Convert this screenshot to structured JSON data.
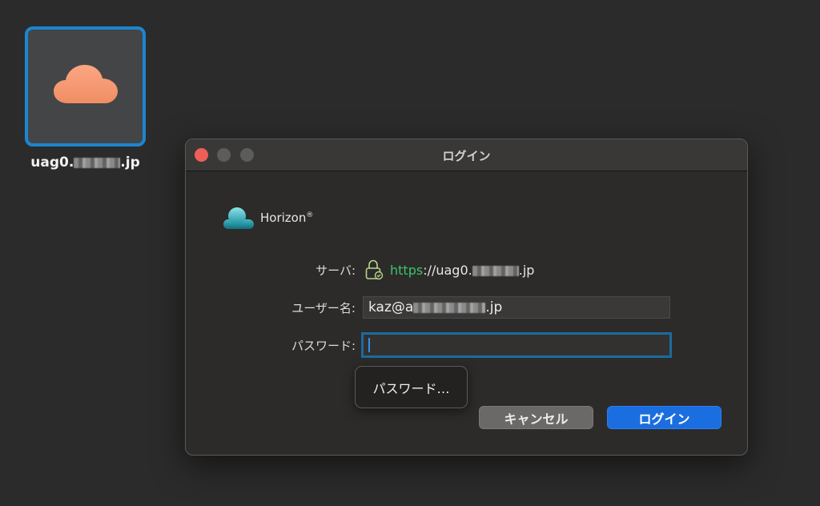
{
  "desktop": {
    "server_label_prefix": "uag0.",
    "server_label_suffix": ".jp"
  },
  "dialog": {
    "title": "ログイン",
    "brand_name": "Horizon",
    "brand_mark": "®",
    "server_label": "サーバ:",
    "server_scheme": "https",
    "server_host_prefix": "://uag0.",
    "server_host_suffix": ".jp",
    "username_label": "ユーザー名:",
    "username_value_prefix": "kaz@a",
    "username_value_suffix": ".jp",
    "password_label": "パスワード:",
    "password_value": "",
    "autofill_label": "パスワード…",
    "cancel_label": "キャンセル",
    "login_label": "ログイン"
  },
  "colors": {
    "accent": "#1a6ee0",
    "focus_ring": "#1c6a9e",
    "https_green": "#3cc46a",
    "cloud_orange": "#f59a71",
    "close_red": "#ee5f57"
  },
  "icons": {
    "tile": "cloud-icon",
    "brand": "horizon-logo-icon",
    "secure": "lock-icon"
  }
}
